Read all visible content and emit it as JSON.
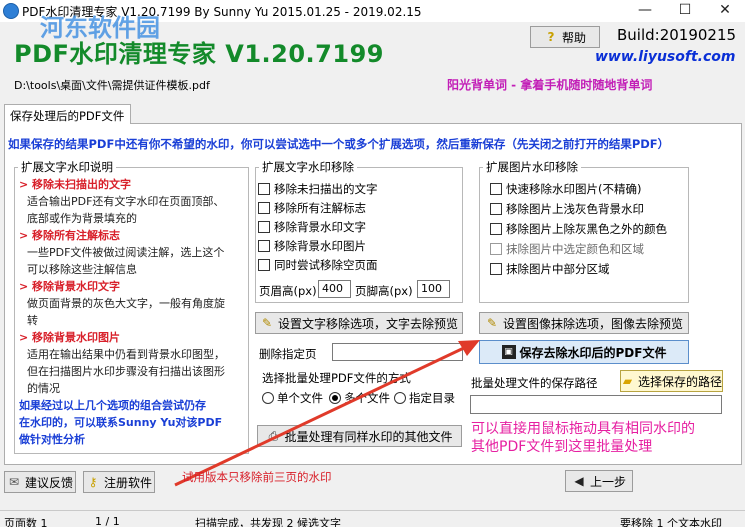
{
  "window": {
    "title": "PDF水印清理专家 V1.20.7199 By Sunny Yu 2015.01.25 - 2019.02.15",
    "watermark": "河东软件园",
    "minimize": "—",
    "maximize": "☐",
    "close": "✕"
  },
  "header": {
    "app_title": "PDF水印清理专家 V1.20.7199",
    "help_label": "帮助",
    "build": "Build:20190215",
    "url": "www.liyusoft.com",
    "file_path": "D:\\tools\\桌面\\文件\\需提供证件模板.pdf",
    "slogan": "阳光背单词 - 拿着手机随时随地背单词"
  },
  "tab": {
    "label": "保存处理后的PDF文件"
  },
  "warning": "如果保存的结果PDF中还有你不希望的水印，你可以尝试选中一个或多个扩展选项，然后重新保存（先关闭之前打开的结果PDF）",
  "help_group": {
    "title": "扩展文字水印说明",
    "lines": [
      {
        "t": "h",
        "text": "> 移除未扫描出的文字"
      },
      {
        "t": "n",
        "text": "适合输出PDF还有文字水印在页面顶部、"
      },
      {
        "t": "n",
        "text": "底部或作为背景填充的"
      },
      {
        "t": "h",
        "text": "> 移除所有注解标志"
      },
      {
        "t": "n",
        "text": "一些PDF文件被做过阅读注解，选上这个"
      },
      {
        "t": "n",
        "text": "可以移除这些注解信息"
      },
      {
        "t": "h",
        "text": "> 移除背景水印文字"
      },
      {
        "t": "n",
        "text": "做页面背景的灰色大文字，一般有角度旋"
      },
      {
        "t": "n",
        "text": "转"
      },
      {
        "t": "h",
        "text": "> 移除背景水印图片"
      },
      {
        "t": "n",
        "text": "适用在输出结果中仍看到背景水印图型，"
      },
      {
        "t": "n",
        "text": "但在扫描图片水印步骤没有扫描出该图形"
      },
      {
        "t": "n",
        "text": "的情况"
      },
      {
        "t": "b",
        "text": "如果经过以上几个选项的组合尝试仍存"
      },
      {
        "t": "b",
        "text": "在水印的，可以联系Sunny Yu对该PDF"
      },
      {
        "t": "b",
        "text": "做针对性分析"
      }
    ]
  },
  "text_group": {
    "title": "扩展文字水印移除",
    "options": [
      "移除未扫描出的文字",
      "移除所有注解标志",
      "移除背景水印文字",
      "移除背景水印图片",
      "同时尝试移除空页面"
    ],
    "header_label": "页眉高(px)",
    "header_value": "400",
    "footer_label": "页脚高(px)",
    "footer_value": "100",
    "preview_button": "设置文字移除选项，文字去除预览"
  },
  "image_group": {
    "title": "扩展图片水印移除",
    "options": [
      {
        "label": "快速移除水印图片(不精确)",
        "disabled": false
      },
      {
        "label": "移除图片上浅灰色背景水印",
        "disabled": false
      },
      {
        "label": "移除图片上除灰黑色之外的颜色",
        "disabled": false
      },
      {
        "label": "抹除图片中选定颜色和区域",
        "disabled": true
      },
      {
        "label": "抹除图片中部分区域",
        "disabled": false
      }
    ],
    "preview_button": "设置图像抹除选项，图像去除预览"
  },
  "save_button": "保存去除水印后的PDF文件",
  "delete_pages_label": "删除指定页",
  "delete_pages_value": "",
  "batch_mode_label": "选择批量处理PDF文件的方式",
  "batch_modes": [
    {
      "label": "单个文件",
      "selected": false
    },
    {
      "label": "多个文件",
      "selected": true
    },
    {
      "label": "指定目录",
      "selected": false
    }
  ],
  "batch_save_label": "批量处理文件的保存路径",
  "choose_path_button": "选择保存的路径",
  "batch_save_value": "",
  "batch_button": "批量处理有同样水印的其他文件",
  "drop_hint_1": "可以直接用鼠标拖动具有相同水印的",
  "drop_hint_2": "其他PDF文件到这里批量处理",
  "footer": {
    "feedback_button": "建议反馈",
    "register_button": "注册软件",
    "trial_notice": "试用版本只移除前三页的水印",
    "prev_button": "上一步"
  },
  "statusbar": {
    "pages_label": "页面数 1",
    "page_index": "1 / 1",
    "scan_status": "扫描完成，共发现 2 候选文字",
    "remove_info": "要移除 1 个文本水印"
  },
  "colors": {
    "title_green": "#138a2a",
    "warning_blue": "#1a3fd6",
    "help_red": "#d8202a",
    "slogan_magenta": "#c21eb7",
    "drop_hint_pink": "#e61fa1",
    "arrow_red": "#e03a2a"
  }
}
